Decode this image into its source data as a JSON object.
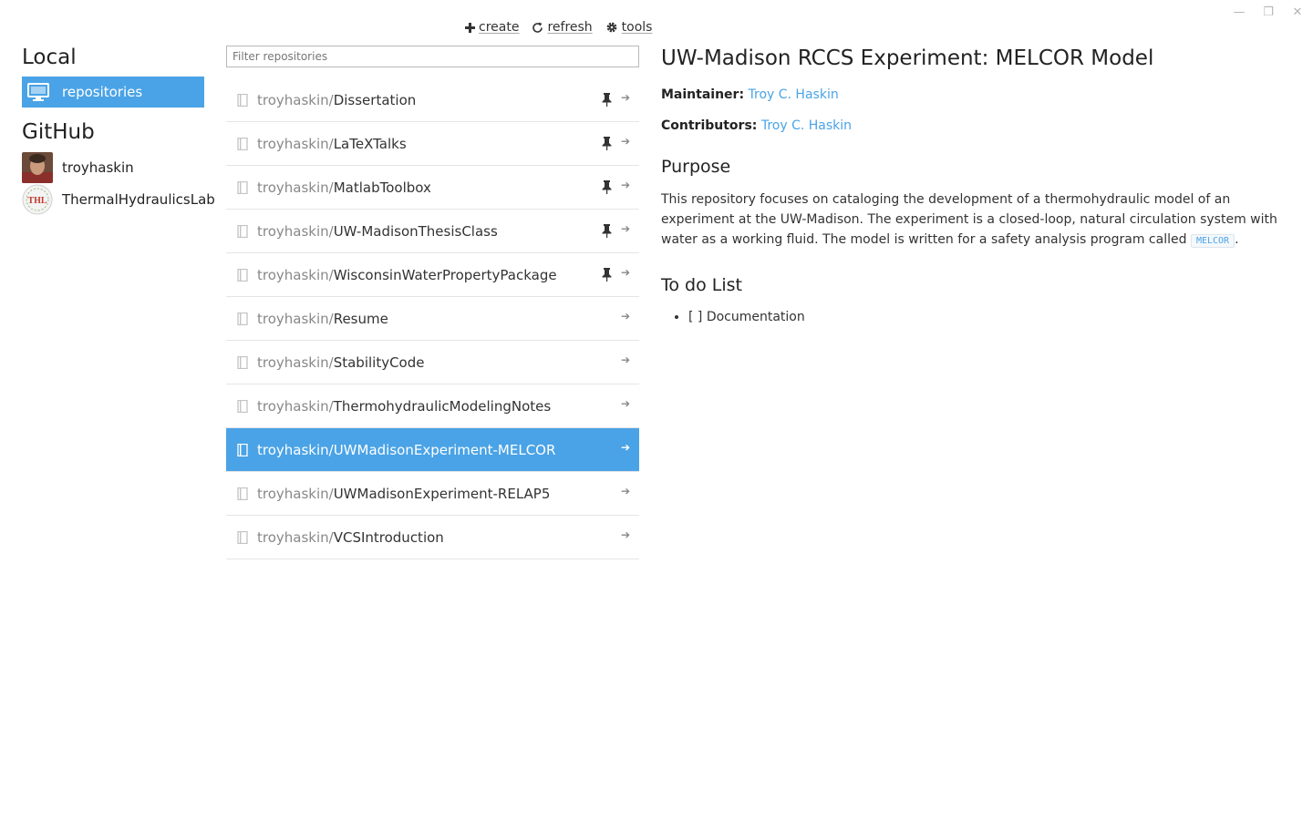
{
  "window": {
    "minimize_glyph": "—",
    "restore_glyph": "❐",
    "close_glyph": "✕"
  },
  "sidebar": {
    "local_heading": "Local",
    "local_items": [
      {
        "label": "repositories",
        "icon": "monitor-icon",
        "active": true
      }
    ],
    "github_heading": "GitHub",
    "github_items": [
      {
        "label": "troyhaskin",
        "icon": "user-avatar"
      },
      {
        "label": "ThermalHydraulicsLab",
        "icon": "org-avatar",
        "avatar_text": "THL"
      }
    ]
  },
  "toolbar": {
    "create_label": "create",
    "refresh_label": "refresh",
    "tools_label": "tools"
  },
  "filter": {
    "placeholder": "Filter repositories",
    "value": ""
  },
  "repos": [
    {
      "owner": "troyhaskin/",
      "name": "Dissertation",
      "pinned": true,
      "selected": false
    },
    {
      "owner": "troyhaskin/",
      "name": "LaTeXTalks",
      "pinned": true,
      "selected": false
    },
    {
      "owner": "troyhaskin/",
      "name": "MatlabToolbox",
      "pinned": true,
      "selected": false
    },
    {
      "owner": "troyhaskin/",
      "name": "UW-MadisonThesisClass",
      "pinned": true,
      "selected": false
    },
    {
      "owner": "troyhaskin/",
      "name": "WisconsinWaterPropertyPackage",
      "pinned": true,
      "selected": false
    },
    {
      "owner": "troyhaskin/",
      "name": "Resume",
      "pinned": false,
      "selected": false
    },
    {
      "owner": "troyhaskin/",
      "name": "StabilityCode",
      "pinned": false,
      "selected": false
    },
    {
      "owner": "troyhaskin/",
      "name": "ThermohydraulicModelingNotes",
      "pinned": false,
      "selected": false
    },
    {
      "owner": "troyhaskin/",
      "name": "UWMadisonExperiment-MELCOR",
      "pinned": false,
      "selected": true
    },
    {
      "owner": "troyhaskin/",
      "name": "UWMadisonExperiment-RELAP5",
      "pinned": false,
      "selected": false
    },
    {
      "owner": "troyhaskin/",
      "name": "VCSIntroduction",
      "pinned": false,
      "selected": false
    }
  ],
  "arrow_glyph": "➔",
  "detail": {
    "title": "UW-Madison RCCS Experiment: MELCOR Model",
    "maintainer_label": "Maintainer:",
    "maintainer": "Troy C. Haskin",
    "contributors_label": "Contributors:",
    "contributors": "Troy C. Haskin",
    "purpose_heading": "Purpose",
    "purpose_text": "This repository focuses on cataloging the development of a thermohydraulic model of an experiment at the UW-Madison. The experiment is a closed-loop, natural circulation system with water as a working fluid. The model is written for a safety analysis program called ",
    "purpose_code": "MELCOR",
    "purpose_end": ".",
    "todo_heading": "To do List",
    "todo_items": [
      "[ ] Documentation"
    ]
  },
  "colors": {
    "accent": "#4aa3e6",
    "border": "#e5e5e5",
    "muted": "#888888"
  }
}
